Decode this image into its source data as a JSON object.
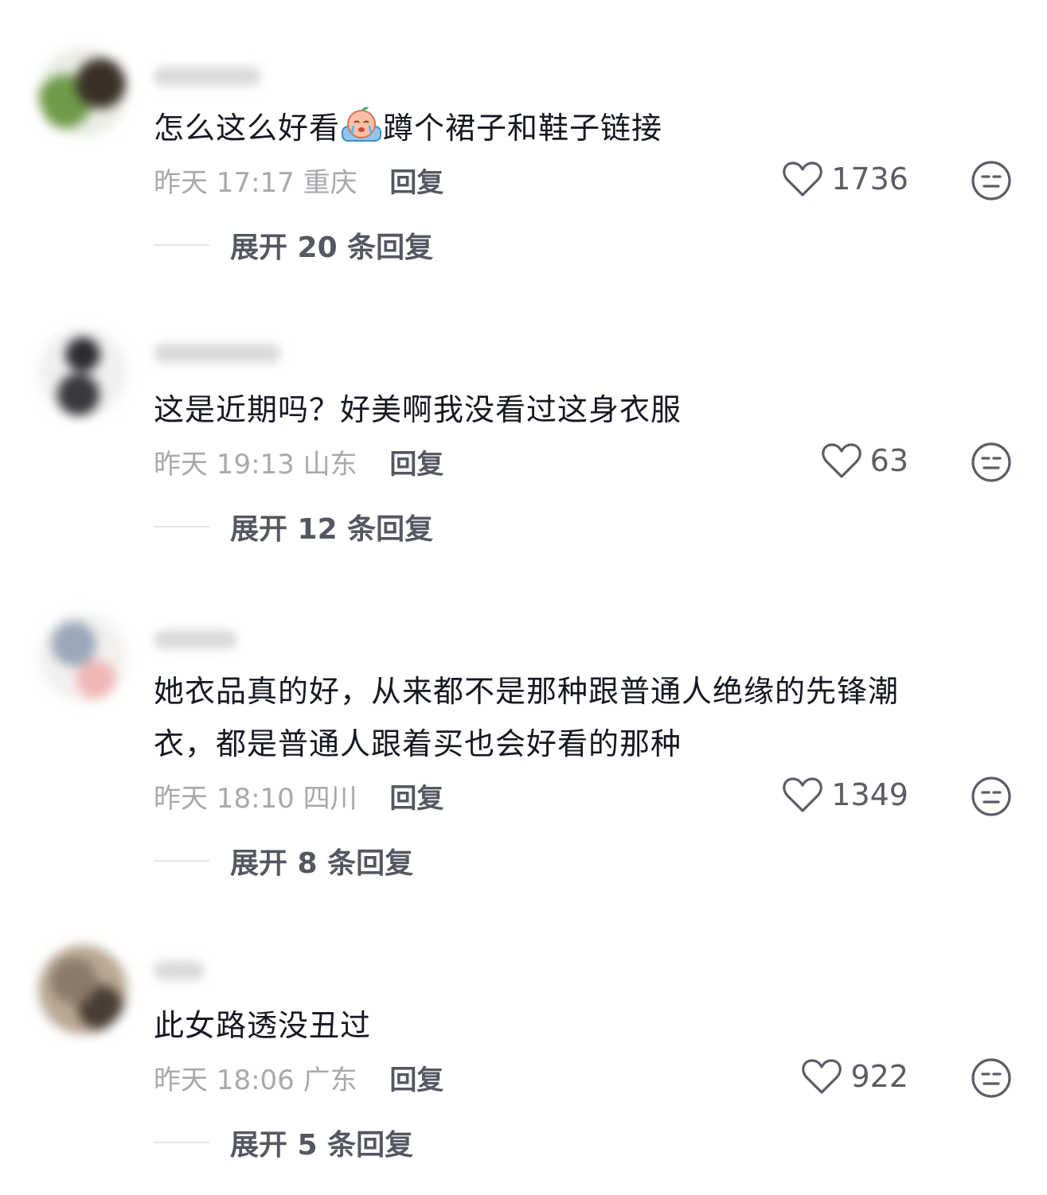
{
  "comments": [
    {
      "username": "lllllllaaaaa",
      "text_before_emoji": "怎么这么好看",
      "emoji": "crying-face-emoji",
      "text_after_emoji": "蹲个裙子和鞋子链接",
      "time": "昨天 17:17",
      "location": "重庆",
      "reply_label": "回复",
      "likes": "1736",
      "expand_label": "展开 20 条回复"
    },
    {
      "username": "aaaaaaaaaaaa",
      "text": "这是近期吗？好美啊我没看过这身衣服",
      "time": "昨天 19:13",
      "location": "山东",
      "reply_label": "回复",
      "likes": "63",
      "expand_label": "展开 12 条回复"
    },
    {
      "username": "aaaaaaa",
      "text": "她衣品真的好，从来都不是那种跟普通人绝缘的先锋潮衣，都是普通人跟着买也会好看的那种",
      "time": "昨天 18:10",
      "location": "四川",
      "reply_label": "回复",
      "likes": "1349",
      "expand_label": "展开 8 条回复"
    },
    {
      "username": "aaaa",
      "text": "此女路透没丑过",
      "time": "昨天 18:06",
      "location": "广东",
      "reply_label": "回复",
      "likes": "922",
      "expand_label": "展开 5 条回复"
    }
  ],
  "colors": {
    "text_primary": "#161823",
    "text_meta": "#a8a8ad",
    "text_action": "#555862",
    "icon": "#5b5d66"
  }
}
